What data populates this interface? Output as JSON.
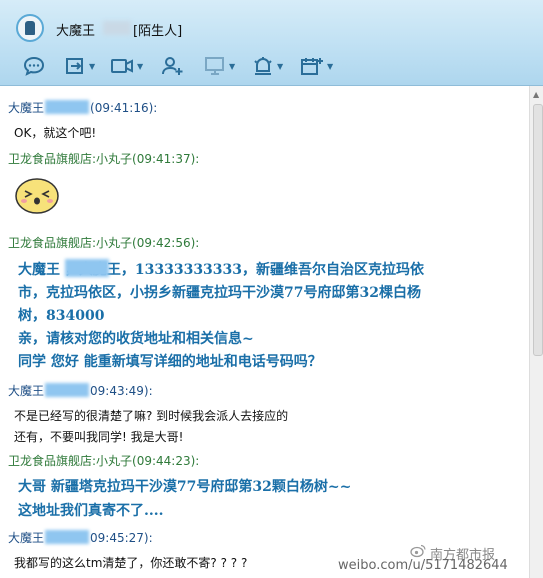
{
  "window": {
    "title_name": "大魔王",
    "title_tag": "[陌生人]"
  },
  "toolbar": {
    "icons": [
      "chat-icon",
      "transfer-icon",
      "video-icon",
      "add-contact-icon",
      "screen-share-icon",
      "remote-assist-icon",
      "app-icon"
    ]
  },
  "messages": [
    {
      "sender": "大魔王",
      "time": "(09:41:16):",
      "lines": [
        "OK，就这个吧!"
      ]
    },
    {
      "sender": "卫龙食品旗舰店:小丸子",
      "time": "(09:41:37):",
      "lines": []
    },
    {
      "sender": "卫龙食品旗舰店:小丸子",
      "time": "(09:42:56):",
      "big_lines": [
        "大魔王      ，大魔王，13333333333，新疆维吾尔自治区克拉玛依",
        "市，克拉玛依区，小拐乡新疆克拉玛干沙漠77号府邸第32棵白杨",
        "树，834000",
        "亲，请核对您的收货地址和相关信息~",
        "同学   您好    能重新填写详细的地址和电话号码吗？"
      ]
    },
    {
      "sender": "大魔王",
      "time": "09:43:49):",
      "lines": [
        "不是已经写的很清楚了嘛? 到时候我会派人去接应的",
        "还有，不要叫我同学! 我是大哥!"
      ]
    },
    {
      "sender": "卫龙食品旗舰店:小丸子",
      "time": "(09:44:23):",
      "big_lines": [
        "大哥       新疆塔克拉玛干沙漠77号府邸第32颗白杨树~~",
        "这地址我们真寄不了...."
      ]
    },
    {
      "sender": "大魔王",
      "time": "09:45:27):",
      "lines": [
        "我都写的这么tm清楚了，你还敢不寄? ? ? ?"
      ]
    }
  ],
  "watermark": {
    "account": "南方都市报",
    "url": "weibo.com/u/5171482644"
  }
}
